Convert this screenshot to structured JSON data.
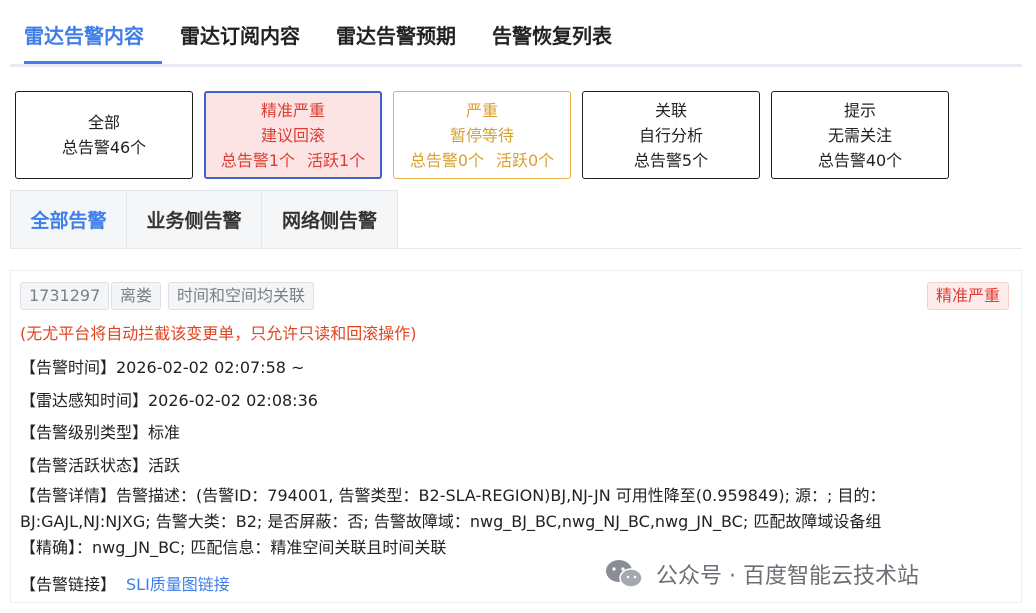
{
  "top_tabs": [
    {
      "label": "雷达告警内容",
      "active": true
    },
    {
      "label": "雷达订阅内容",
      "active": false
    },
    {
      "label": "雷达告警预期",
      "active": false
    },
    {
      "label": "告警恢复列表",
      "active": false
    }
  ],
  "filter_cards": [
    {
      "line1": "全部",
      "line2": "总告警46个"
    },
    {
      "line1": "精准严重",
      "line2": "建议回滚",
      "stat1": "总告警1个",
      "stat2": "活跃1个"
    },
    {
      "line1": "严重",
      "line2": "暂停等待",
      "stat1": "总告警0个",
      "stat2": "活跃0个"
    },
    {
      "line1": "关联",
      "line2": "自行分析",
      "line3": "总告警5个"
    },
    {
      "line1": "提示",
      "line2": "无需关注",
      "line3": "总告警40个"
    }
  ],
  "sub_tabs": [
    {
      "label": "全部告警",
      "active": true
    },
    {
      "label": "业务侧告警",
      "active": false
    },
    {
      "label": "网络侧告警",
      "active": false
    }
  ],
  "alert": {
    "tags": [
      "1731297",
      "离娄",
      "时间和空间均关联"
    ],
    "level": "精准严重",
    "warning": "(无尤平台将自动拦截该变更单，只允许只读和回滚操作)",
    "alarm_time": "【告警时间】2026-02-02 02:07:58 ~",
    "radar_time": "【雷达感知时间】2026-02-02 02:08:36",
    "level_type": "【告警级别类型】标准",
    "active_state": "【告警活跃状态】活跃",
    "detail_lines": [
      "【告警详情】告警描述：(告警ID：794001, 告警类型：B2-SLA-REGION)BJ,NJ-JN 可用性降至(0.959849); 源：; 目的：",
      "BJ:GAJL,NJ:NJXG; 告警大类：B2; 是否屏蔽：否; 告警故障域：nwg_BJ_BC,nwg_NJ_BC,nwg_JN_BC; 匹配故障域设备组",
      "【精确】：nwg_JN_BC; 匹配信息：精准空间关联且时间关联"
    ],
    "link_label": "【告警链接】",
    "link_text": "SLI质量图链接"
  },
  "watermark": {
    "text": "公众号 · 百度智能云技术站",
    "icon": "wechat-icon"
  },
  "colors": {
    "accent": "#3f7ee8",
    "danger": "#e03c32",
    "warning": "#d8a02f"
  }
}
